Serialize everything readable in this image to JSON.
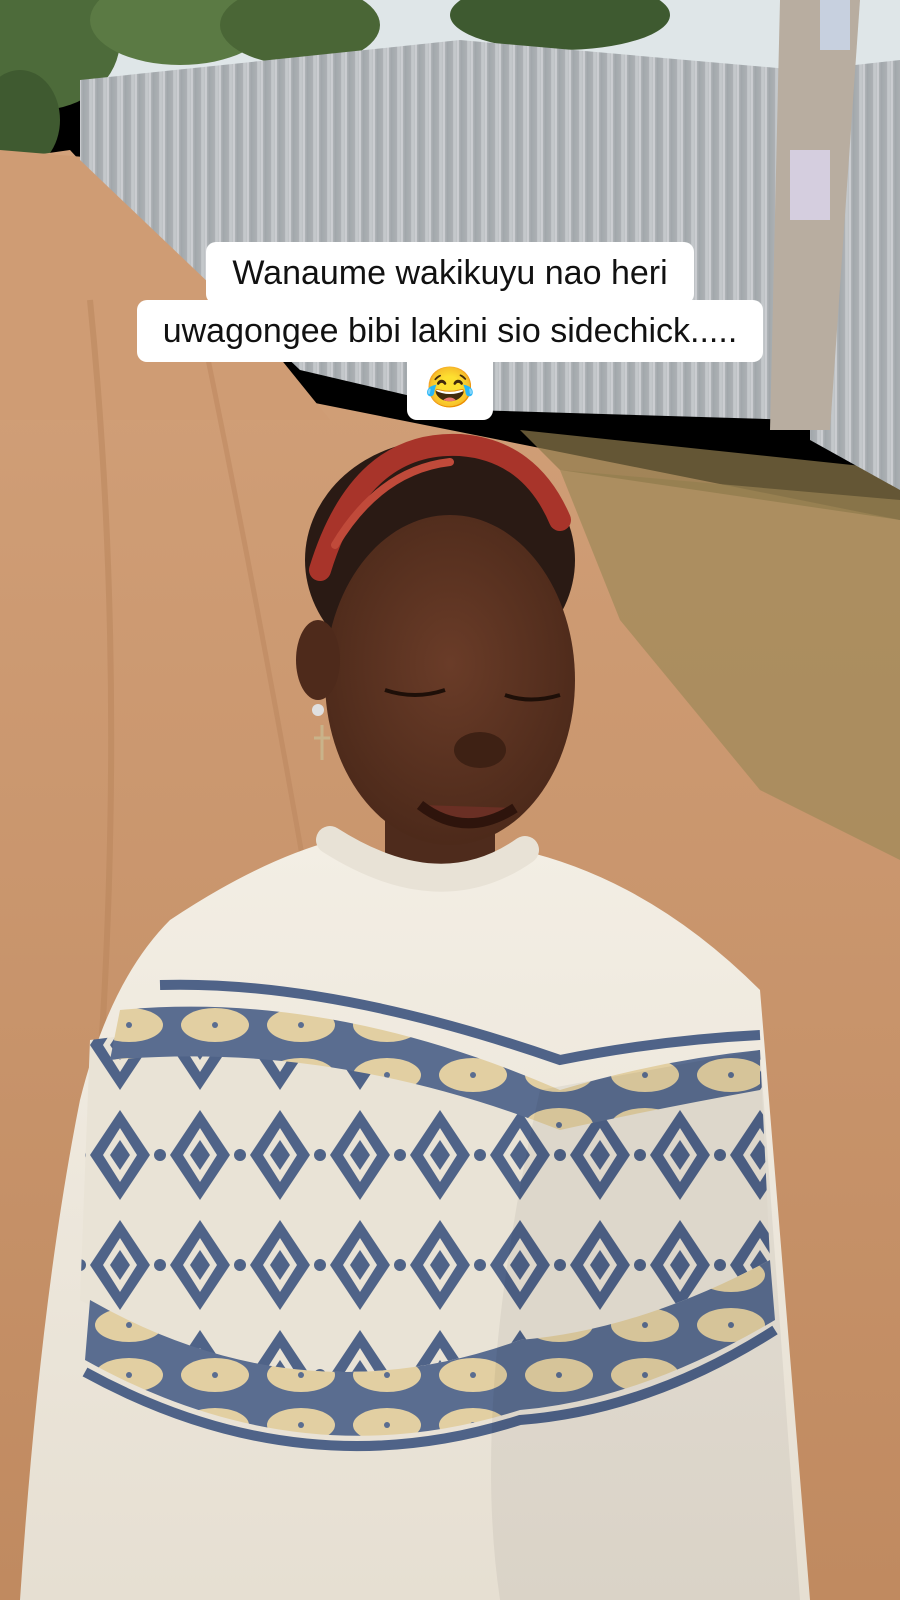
{
  "caption": {
    "line1": "Wanaume wakikuyu  nao heri",
    "line2": "uwagongee bibi lakini sio sidechick.....",
    "line3": "😂"
  },
  "colors": {
    "sky": "#dfe6e8",
    "dirt_road": "#c9946b",
    "dirt_dark": "#b07a52",
    "iron_fence": "#b9bec2",
    "trees": "#4d6b3a",
    "dry_grass": "#a08a5a",
    "skin": "#5a3322",
    "hair_red": "#a8342a",
    "hair_dark": "#2a1a14",
    "sweater_cream": "#efe9dd",
    "sweater_pattern_blue": "#4f6388",
    "sweater_pattern_tan": "#e2cfa2"
  }
}
